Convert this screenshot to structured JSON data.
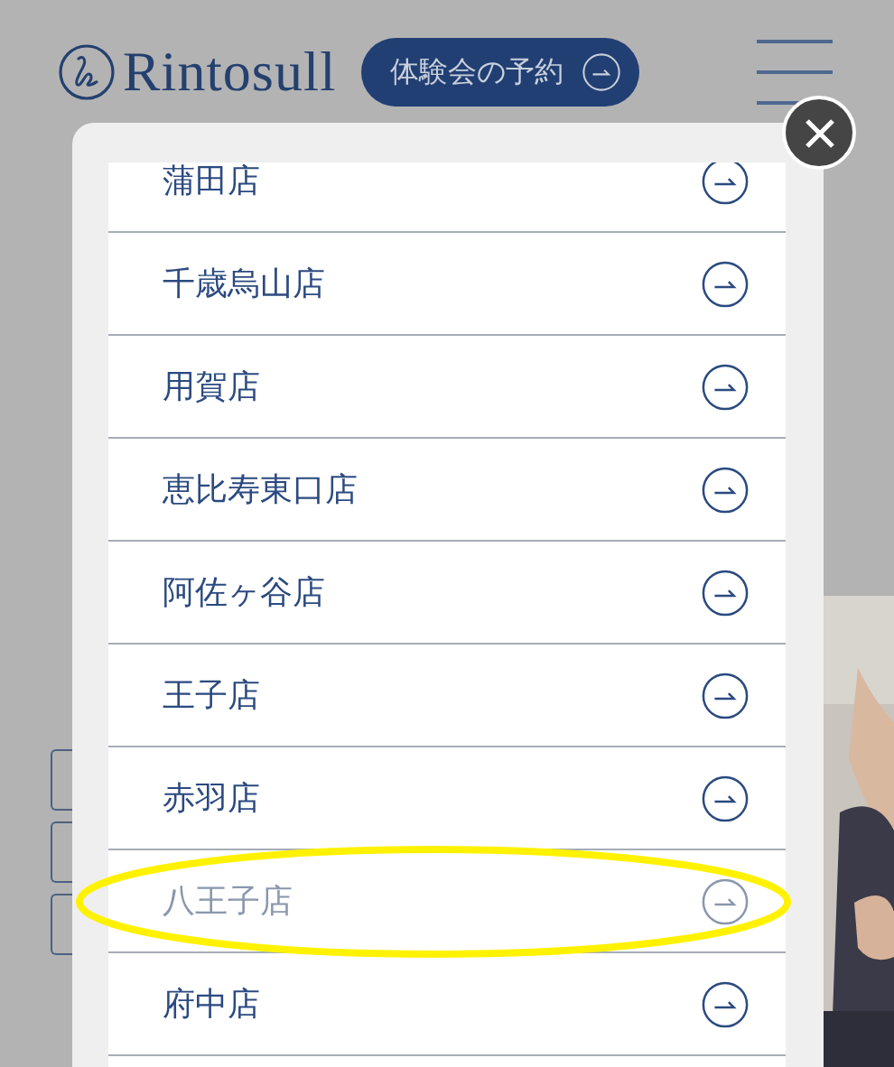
{
  "header": {
    "logo": "Rintosull",
    "reserve_button": "体験会の予約"
  },
  "store_list": [
    {
      "name": "蒲田店",
      "disabled": false,
      "circled": false
    },
    {
      "name": "千歳烏山店",
      "disabled": false,
      "circled": false
    },
    {
      "name": "用賀店",
      "disabled": false,
      "circled": false
    },
    {
      "name": "恵比寿東口店",
      "disabled": false,
      "circled": false
    },
    {
      "name": "阿佐ヶ谷店",
      "disabled": false,
      "circled": false
    },
    {
      "name": "王子店",
      "disabled": false,
      "circled": false
    },
    {
      "name": "赤羽店",
      "disabled": false,
      "circled": false
    },
    {
      "name": "八王子店",
      "disabled": true,
      "circled": true
    },
    {
      "name": "府中店",
      "disabled": false,
      "circled": false
    }
  ]
}
